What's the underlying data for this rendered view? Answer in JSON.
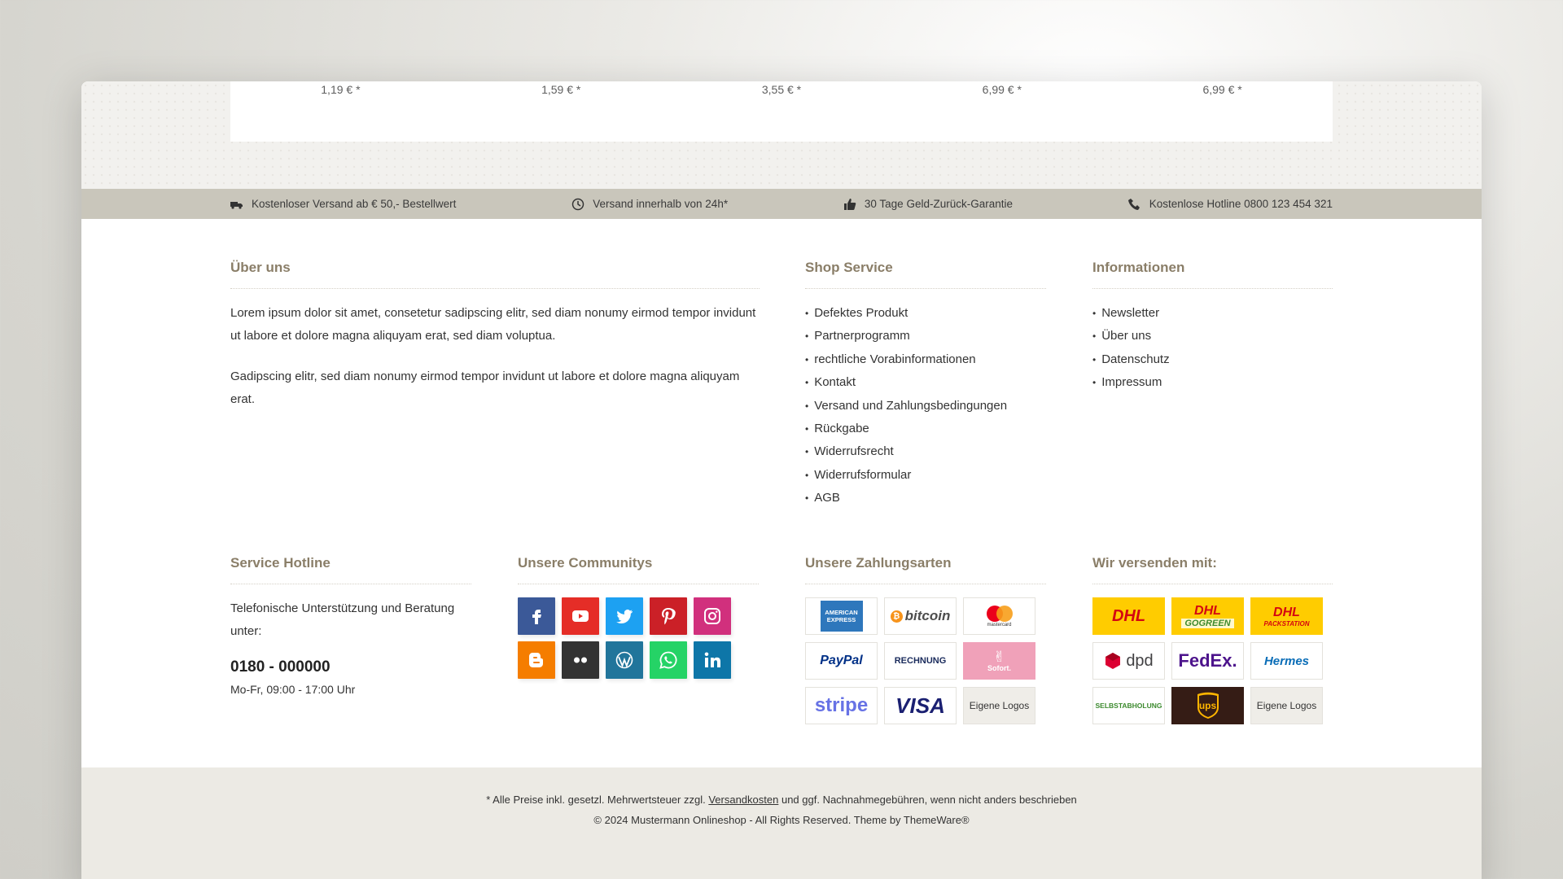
{
  "prices": [
    "1,19 € *",
    "1,59 € *",
    "3,55 € *",
    "6,99 € *",
    "6,99 € *"
  ],
  "usp": {
    "shipping": "Kostenloser Versand ab € 50,- Bestellwert",
    "delivery": "Versand innerhalb von 24h*",
    "guarantee": "30 Tage Geld-Zurück-Garantie",
    "hotline": "Kostenlose Hotline 0800 123 454 321"
  },
  "about": {
    "title": "Über uns",
    "p1": "Lorem ipsum dolor sit amet, consetetur sadipscing elitr, sed diam nonumy eirmod tempor invidunt ut labore et dolore magna aliquyam erat, sed diam voluptua.",
    "p2": "Gadipscing elitr, sed diam nonumy eirmod tempor invidunt ut labore et dolore magna aliquyam erat."
  },
  "shop_service": {
    "title": "Shop Service",
    "items": [
      "Defektes Produkt",
      "Partnerprogramm",
      "rechtliche Vorabinformationen",
      "Kontakt",
      "Versand und Zahlungsbedingungen",
      "Rückgabe",
      "Widerrufsrecht",
      "Widerrufsformular",
      "AGB"
    ]
  },
  "informationen": {
    "title": "Informationen",
    "items": [
      "Newsletter",
      "Über uns",
      "Datenschutz",
      "Impressum"
    ]
  },
  "service_hotline": {
    "title": "Service Hotline",
    "text": "Telefonische Unterstützung und Beratung unter:",
    "number": "0180 - 000000",
    "hours": "Mo-Fr, 09:00 - 17:00 Uhr"
  },
  "communities": {
    "title": "Unsere Communitys",
    "icons": [
      {
        "name": "facebook-icon",
        "color": "#3b5998"
      },
      {
        "name": "youtube-icon",
        "color": "#e52d27"
      },
      {
        "name": "twitter-icon",
        "color": "#1da1f2"
      },
      {
        "name": "pinterest-icon",
        "color": "#cb2027"
      },
      {
        "name": "instagram-icon",
        "color": "#d1307d"
      },
      {
        "name": "blogger-icon",
        "color": "#f57d00"
      },
      {
        "name": "flickr-icon",
        "color": "#333333"
      },
      {
        "name": "wordpress-icon",
        "color": "#21759b"
      },
      {
        "name": "whatsapp-icon",
        "color": "#25d366"
      },
      {
        "name": "linkedin-icon",
        "color": "#0e76a8"
      }
    ]
  },
  "payments": {
    "title": "Unsere Zahlungsarten",
    "items": [
      {
        "name": "american-express-logo",
        "label": "AMERICAN EXPRESS"
      },
      {
        "name": "bitcoin-logo",
        "label": "bitcoin"
      },
      {
        "name": "mastercard-logo",
        "label": "mastercard"
      },
      {
        "name": "paypal-logo",
        "label": "PayPal"
      },
      {
        "name": "rechnung-logo",
        "label": "RECHNUNG"
      },
      {
        "name": "sofort-logo",
        "label": "Sofort."
      },
      {
        "name": "stripe-logo",
        "label": "stripe"
      },
      {
        "name": "visa-logo",
        "label": "VISA"
      },
      {
        "name": "custom-logos-tile",
        "label": "Eigene Logos"
      }
    ]
  },
  "shipping": {
    "title": "Wir versenden mit:",
    "items": [
      {
        "name": "dhl-logo",
        "label": "DHL"
      },
      {
        "name": "dhl-gogreen-logo",
        "label": "DHL",
        "sub": "GOGREEN"
      },
      {
        "name": "dhl-packstation-logo",
        "label": "DHL",
        "sub": "PACKSTATION"
      },
      {
        "name": "dpd-logo",
        "label": "dpd"
      },
      {
        "name": "fedex-logo",
        "label": "FedEx."
      },
      {
        "name": "hermes-logo",
        "label": "Hermes"
      },
      {
        "name": "selbstabholung-logo",
        "label": "SELBSTABHOLUNG"
      },
      {
        "name": "ups-logo",
        "label": "ups"
      },
      {
        "name": "custom-logos-tile",
        "label": "Eigene Logos"
      }
    ]
  },
  "footer": {
    "line1_before": "* Alle Preise inkl. gesetzl. Mehrwertsteuer zzgl.",
    "line1_link": "Versandkosten",
    "line1_after": "und ggf. Nachnahmegebühren, wenn nicht anders beschrieben",
    "line2": "© 2024 Mustermann Onlineshop - All Rights Reserved. Theme by ThemeWare®"
  }
}
